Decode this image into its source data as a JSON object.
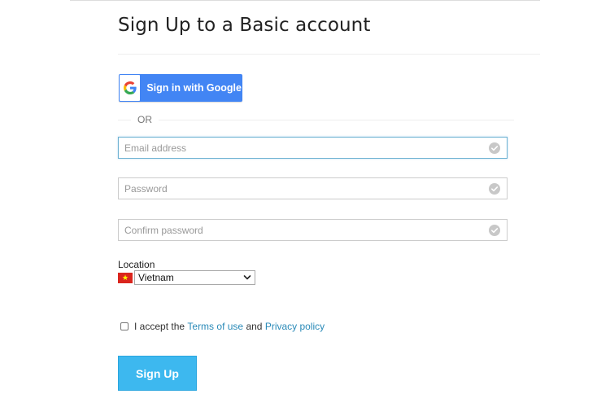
{
  "page": {
    "title": "Sign Up to a Basic account"
  },
  "google": {
    "label": "Sign in with Google",
    "icon": "google-g-icon"
  },
  "divider": {
    "text": "OR"
  },
  "fields": {
    "email": {
      "placeholder": "Email address",
      "value": ""
    },
    "password": {
      "placeholder": "Password",
      "value": ""
    },
    "confirm": {
      "placeholder": "Confirm password",
      "value": ""
    },
    "valid_icon": "check-circle-icon"
  },
  "location": {
    "label": "Location",
    "selected": "Vietnam",
    "flag_icon": "vietnam-flag-icon"
  },
  "terms": {
    "prefix": "I accept the",
    "terms_link": "Terms of use",
    "conjunction": "and",
    "privacy_link": "Privacy policy",
    "checked": false
  },
  "signup": {
    "label": "Sign Up"
  },
  "colors": {
    "google_blue": "#4285f4",
    "signup_blue": "#3db8ef",
    "link": "#2a8ab8"
  }
}
